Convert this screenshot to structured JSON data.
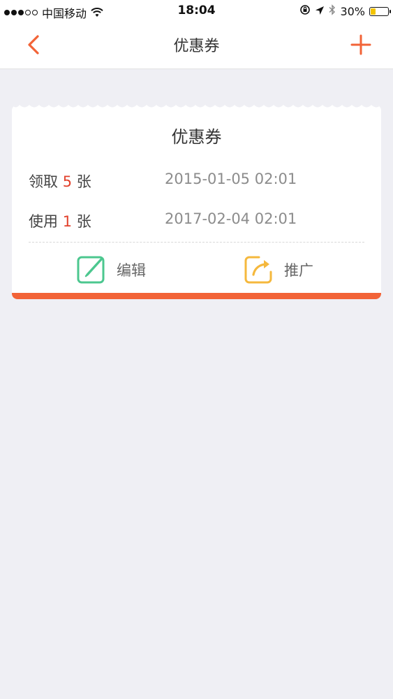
{
  "status_bar": {
    "carrier": "中国移动",
    "time": "18:04",
    "battery_percent": "30%",
    "battery_level": 0.3
  },
  "nav": {
    "title": "优惠券"
  },
  "card": {
    "title": "优惠券",
    "rows": [
      {
        "prefix": "领取",
        "count": "5",
        "suffix": "张",
        "date": "2015-01-05 02:01"
      },
      {
        "prefix": "使用",
        "count": "1",
        "suffix": "张",
        "date": "2017-02-04 02:01"
      }
    ],
    "actions": {
      "edit_label": "编辑",
      "promote_label": "推广"
    }
  },
  "colors": {
    "accent": "#f26337",
    "count_red": "#e2412c",
    "edit_green": "#4cc78f",
    "promote_yellow": "#f5b83d",
    "background": "#efeff4"
  },
  "icons": {
    "back": "chevron-left-icon",
    "add": "plus-icon",
    "edit": "edit-icon",
    "promote": "share-icon"
  }
}
